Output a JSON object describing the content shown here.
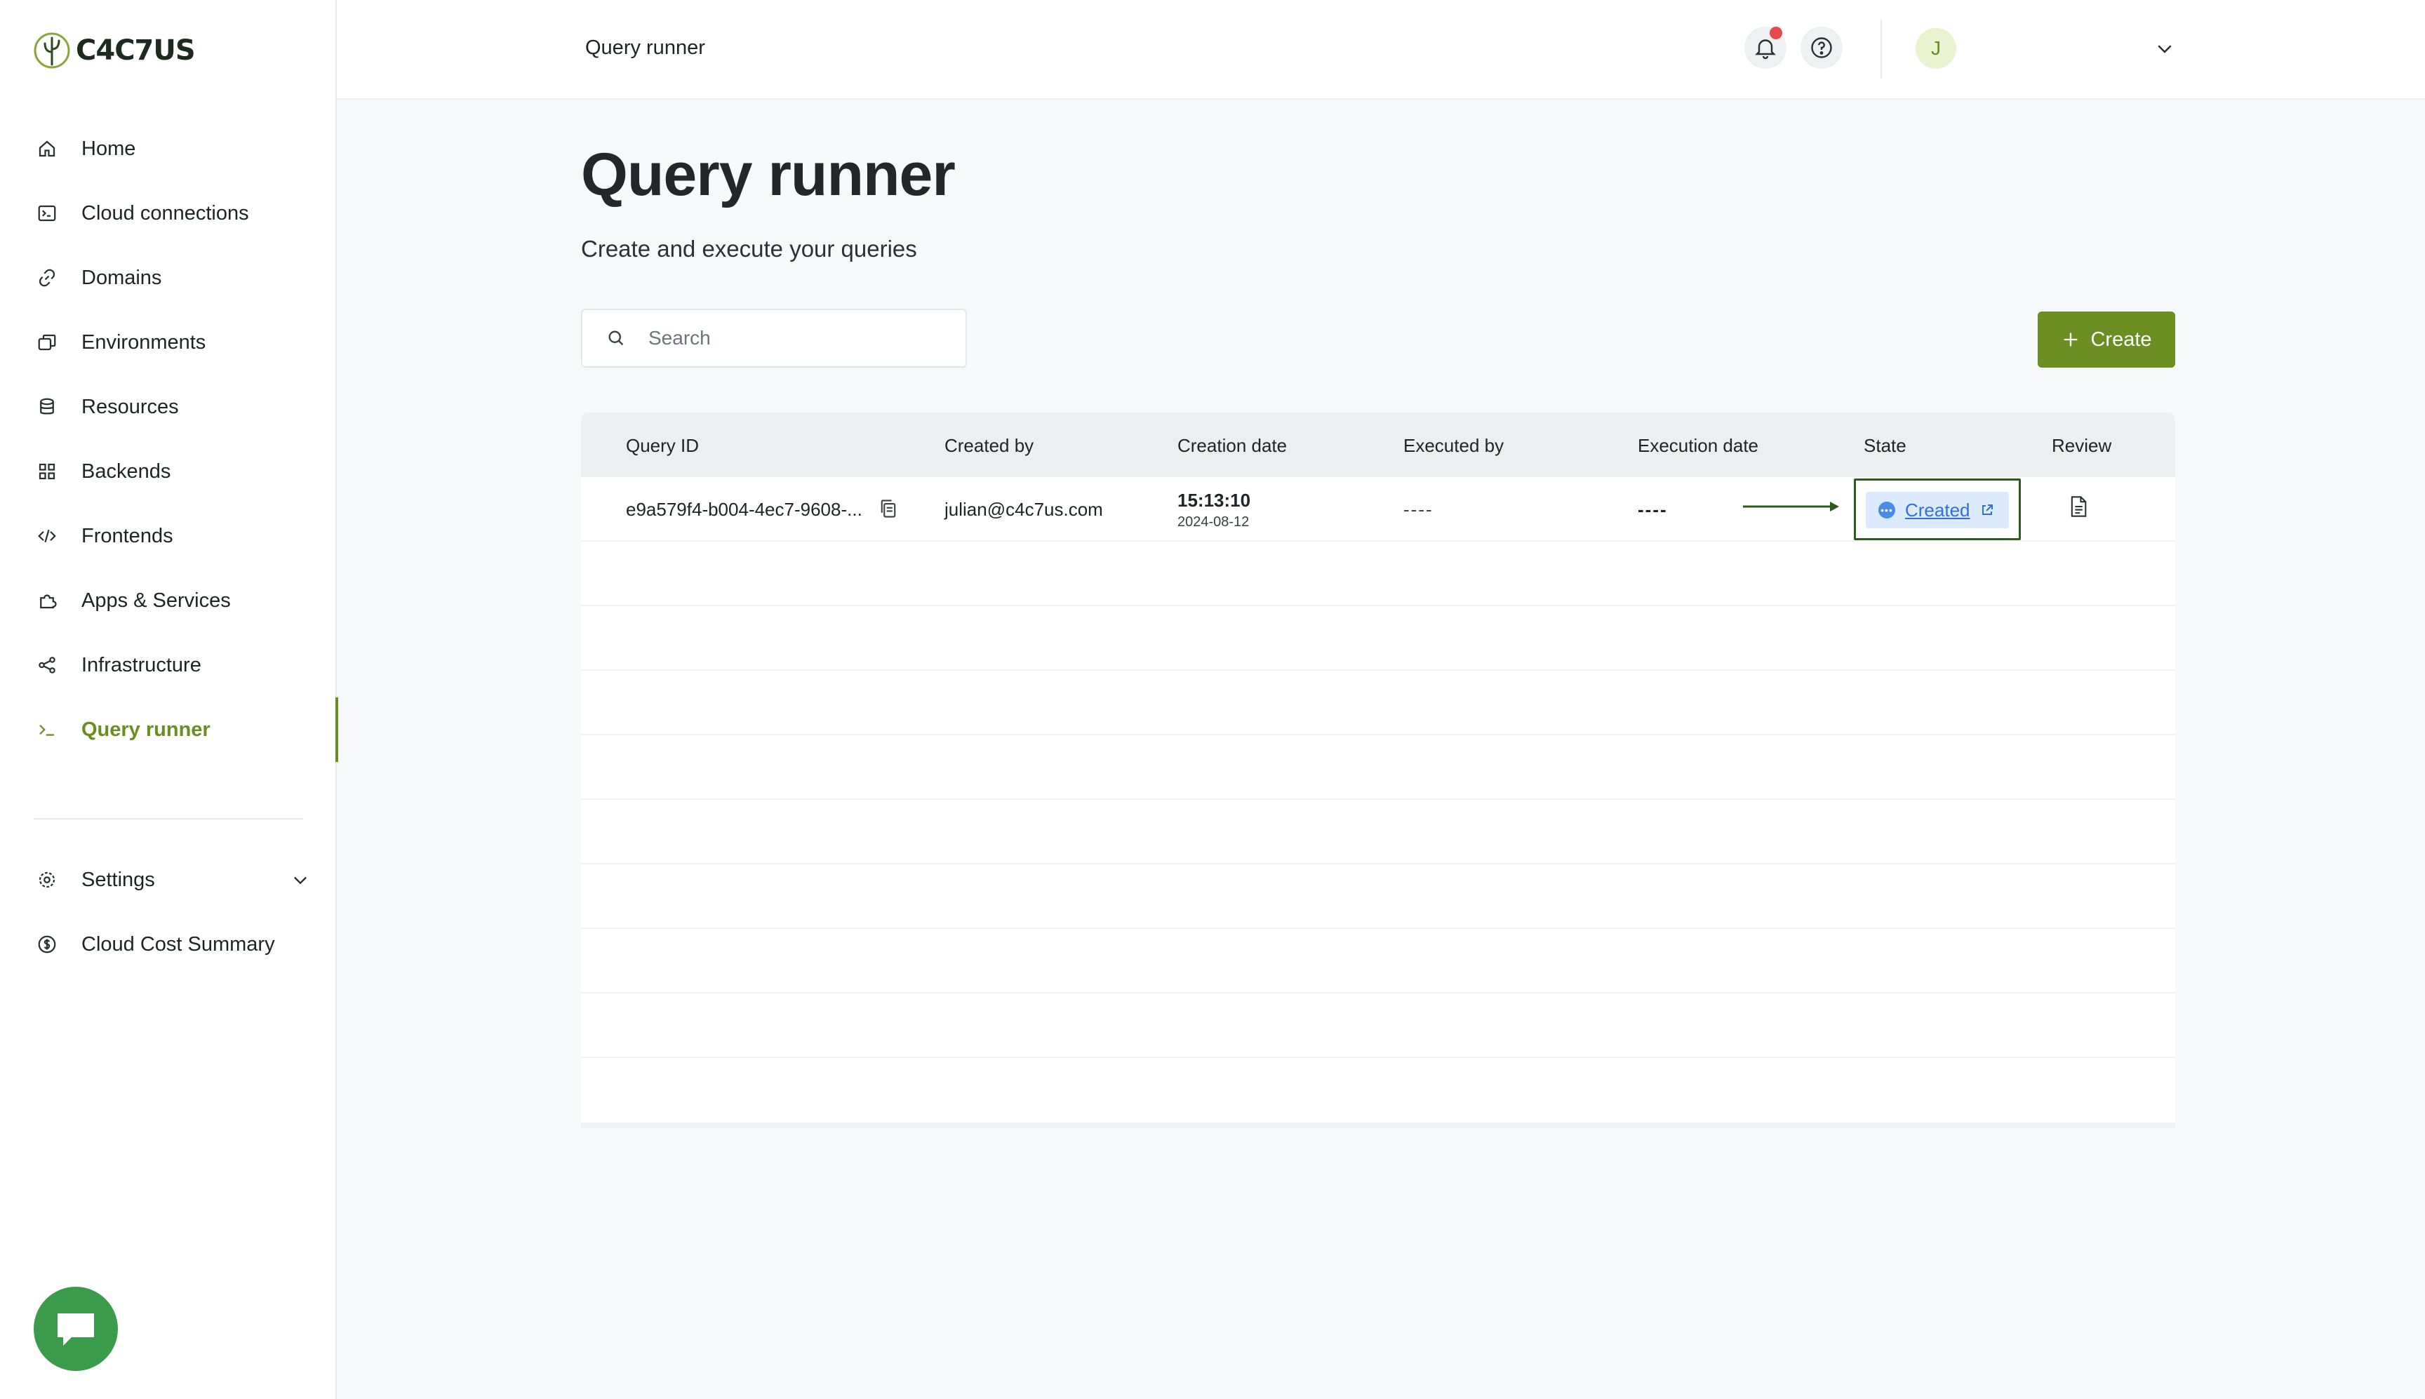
{
  "brand": {
    "name": "C4C7US",
    "accent": "#6b8e23"
  },
  "sidebar": {
    "items": [
      {
        "label": "Home",
        "icon": "home-icon"
      },
      {
        "label": "Cloud connections",
        "icon": "terminal-box-icon"
      },
      {
        "label": "Domains",
        "icon": "link-icon"
      },
      {
        "label": "Environments",
        "icon": "environments-icon"
      },
      {
        "label": "Resources",
        "icon": "database-icon"
      },
      {
        "label": "Backends",
        "icon": "grid-icon"
      },
      {
        "label": "Frontends",
        "icon": "code-icon"
      },
      {
        "label": "Apps & Services",
        "icon": "puzzle-icon"
      },
      {
        "label": "Infrastructure",
        "icon": "nodes-icon"
      },
      {
        "label": "Query runner",
        "icon": "prompt-icon",
        "active": true
      }
    ],
    "secondary": [
      {
        "label": "Settings",
        "icon": "gear-icon"
      },
      {
        "label": "Cloud Cost Summary",
        "icon": "dollar-icon"
      }
    ]
  },
  "header": {
    "title": "Query runner",
    "user_initial": "J"
  },
  "main": {
    "title": "Query runner",
    "subtitle": "Create and execute your queries",
    "search_placeholder": "Search",
    "create_label": "Create"
  },
  "table": {
    "columns": [
      "Query ID",
      "Created by",
      "Creation date",
      "Executed by",
      "Execution date",
      "State",
      "Review"
    ],
    "rows": [
      {
        "query_id": "e9a579f4-b004-4ec7-9608-...",
        "created_by": "julian@c4c7us.com",
        "creation_time": "15:13:10",
        "creation_date": "2024-08-12",
        "executed_by": "----",
        "execution_date": "----",
        "state": "Created"
      }
    ]
  }
}
